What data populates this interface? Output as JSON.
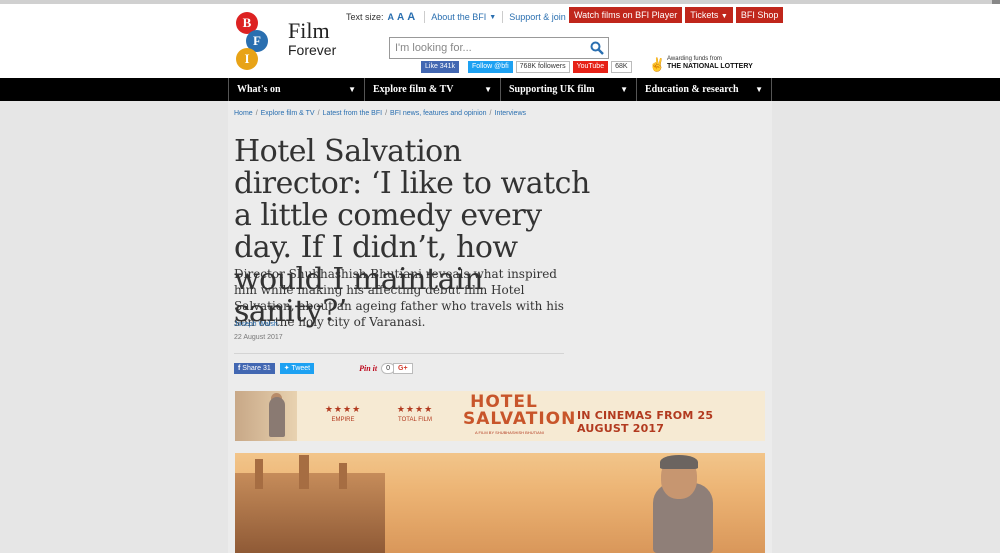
{
  "logo": {
    "letters": [
      "B",
      "F",
      "I"
    ],
    "title": "Film",
    "subtitle": "Forever"
  },
  "utility": {
    "text_size_label": "Text size:",
    "sizes": [
      "A",
      "A",
      "A"
    ],
    "about": "About the BFI",
    "support": "Support & join"
  },
  "red_buttons": {
    "watch": "Watch films on BFI Player",
    "tickets": "Tickets",
    "shop": "BFI Shop"
  },
  "search": {
    "placeholder": "I'm looking for...",
    "icon": "search-icon"
  },
  "social": {
    "fb_like": "Like",
    "fb_count": "341k",
    "tw_follow": "Follow @bfi",
    "tw_count": "768K followers",
    "yt_label": "YouTube",
    "yt_count": "68K"
  },
  "lottery": {
    "line1": "Awarding funds from",
    "line2": "THE NATIONAL LOTTERY"
  },
  "nav": [
    {
      "label": "What's on"
    },
    {
      "label": "Explore film & TV"
    },
    {
      "label": "Supporting UK film"
    },
    {
      "label": "Education & research"
    }
  ],
  "breadcrumbs": [
    "Home",
    "Explore film & TV",
    "Latest from the BFI",
    "BFI news, features and opinion",
    "Interviews"
  ],
  "article": {
    "title": "Hotel Salvation director: ‘I like to watch a little comedy every day. If I didn’t, how would I maintain sanity?’",
    "standfirst": "Director Shubhashish Bhutiani reveals what inspired him while making his affecting debut film Hotel Salvation, about an ageing father who travels with his son to the holy city of Varanasi.",
    "author": "Joseph Walsh",
    "date": "22 August 2017"
  },
  "share": {
    "fb_label": "Share",
    "fb_count": "31",
    "tw_label": "Tweet",
    "pin_label": "Pin it",
    "pin_count": "0",
    "gplus_label": "G+"
  },
  "banner": {
    "review1_stars": "★★★★",
    "review1_source": "EMPIRE",
    "review2_stars": "★★★★",
    "review2_source": "TOTAL FILM",
    "title_line1": "HOTEL",
    "title_line2": "SALVATION",
    "credit": "A FILM BY SHUBHASHISH BHUTIANI",
    "tagline": "IN CINEMAS FROM 25 AUGUST 2017"
  }
}
